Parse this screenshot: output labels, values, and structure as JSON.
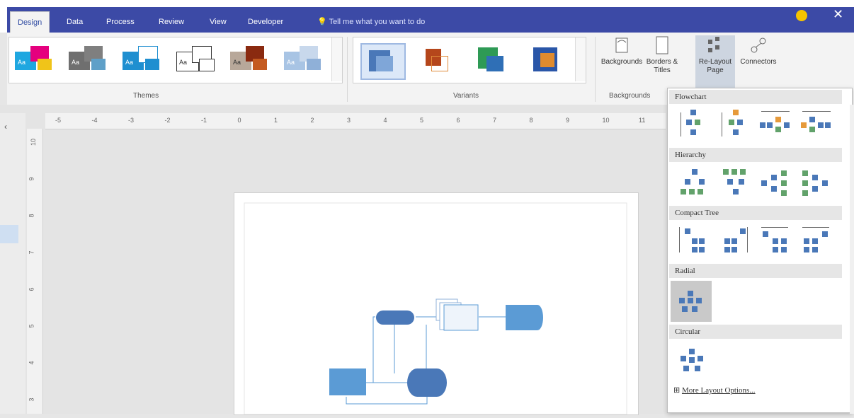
{
  "tabs": [
    "Design",
    "Data",
    "Process",
    "Review",
    "View",
    "Developer"
  ],
  "tell_me": "Tell me what you want to do",
  "close_label": "✕",
  "ribbon": {
    "themes_label": "Themes",
    "variants_label": "Variants",
    "backgrounds_group_label": "Backgrounds",
    "theme_aa": "Aa",
    "backgrounds_btn": "Backgrounds",
    "borders_btn_line1": "Borders &",
    "borders_btn_line2": "Titles",
    "relayout_line1": "Re-Layout",
    "relayout_line2": "Page",
    "connectors_btn": "Connectors"
  },
  "ruler": {
    "h": [
      "-5",
      "-4",
      "-3",
      "-2",
      "-1",
      "0",
      "1",
      "2",
      "3",
      "4",
      "5",
      "6",
      "7",
      "8",
      "9",
      "10",
      "11"
    ],
    "v": [
      "10",
      "9",
      "8",
      "7",
      "6",
      "5",
      "4",
      "3"
    ]
  },
  "dropdown": {
    "sections": [
      "Flowchart",
      "Hierarchy",
      "Compact Tree",
      "Radial",
      "Circular"
    ],
    "more": "More Layout Options..."
  },
  "colors": {
    "tabbar": "#3c4aa6",
    "accent": "#4a78b8",
    "shape": "#5b9bd5"
  }
}
